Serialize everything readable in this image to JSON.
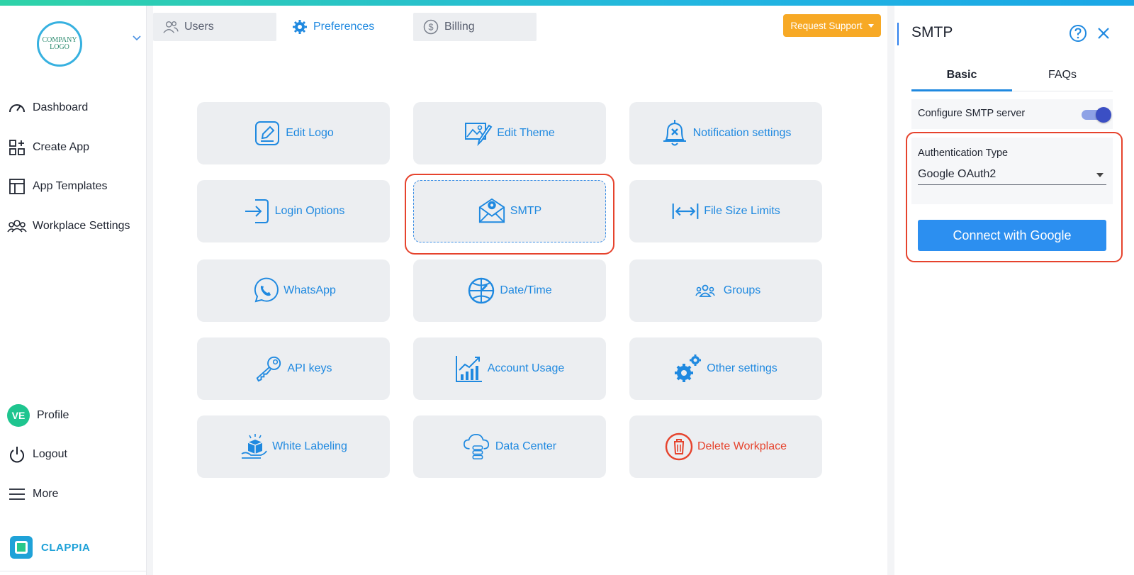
{
  "sidebar": {
    "logo_text": "COMPANY LOGO",
    "nav": [
      {
        "label": "Dashboard",
        "icon": "gauge-icon"
      },
      {
        "label": "Create App",
        "icon": "create-app-icon"
      },
      {
        "label": "App Templates",
        "icon": "templates-icon"
      },
      {
        "label": "Workplace Settings",
        "icon": "users-group-icon"
      }
    ],
    "bottom": [
      {
        "label": "Profile",
        "avatar": "VE"
      },
      {
        "label": "Logout",
        "icon": "power-icon"
      },
      {
        "label": "More",
        "icon": "menu-icon"
      }
    ],
    "brand": "CLAPPIA"
  },
  "tabs": [
    {
      "label": "Users",
      "icon": "users-icon"
    },
    {
      "label": "Preferences",
      "icon": "gear-icon",
      "active": true
    },
    {
      "label": "Billing",
      "icon": "dollar-icon"
    }
  ],
  "support_button": "Request Support",
  "cards": [
    {
      "label": "Edit Logo",
      "icon": "edit-logo-icon"
    },
    {
      "label": "Edit Theme",
      "icon": "edit-theme-icon"
    },
    {
      "label": "Notification settings",
      "icon": "bell-icon"
    },
    {
      "label": "Login Options",
      "icon": "login-icon"
    },
    {
      "label": "SMTP",
      "icon": "mail-gear-icon",
      "selected": true
    },
    {
      "label": "File Size Limits",
      "icon": "width-arrows-icon"
    },
    {
      "label": "WhatsApp",
      "icon": "whatsapp-icon"
    },
    {
      "label": "Date/Time",
      "icon": "globe-icon"
    },
    {
      "label": "Groups",
      "icon": "groups-icon"
    },
    {
      "label": "API keys",
      "icon": "key-icon"
    },
    {
      "label": "Account Usage",
      "icon": "chart-icon"
    },
    {
      "label": "Other settings",
      "icon": "gears-icon"
    },
    {
      "label": "White Labeling",
      "icon": "box-icon"
    },
    {
      "label": "Data Center",
      "icon": "cloud-db-icon"
    },
    {
      "label": "Delete Workplace",
      "icon": "trash-icon",
      "danger": true
    }
  ],
  "panel": {
    "title": "SMTP",
    "tabs": [
      {
        "label": "Basic",
        "active": true
      },
      {
        "label": "FAQs"
      }
    ],
    "config_label": "Configure SMTP server",
    "config_enabled": true,
    "auth_label": "Authentication Type",
    "auth_value": "Google OAuth2",
    "connect_label": "Connect with Google"
  },
  "colors": {
    "accent": "#1f89e0",
    "danger": "#e6432d",
    "support": "#f7a925",
    "toggle": "#3b4fc4"
  }
}
